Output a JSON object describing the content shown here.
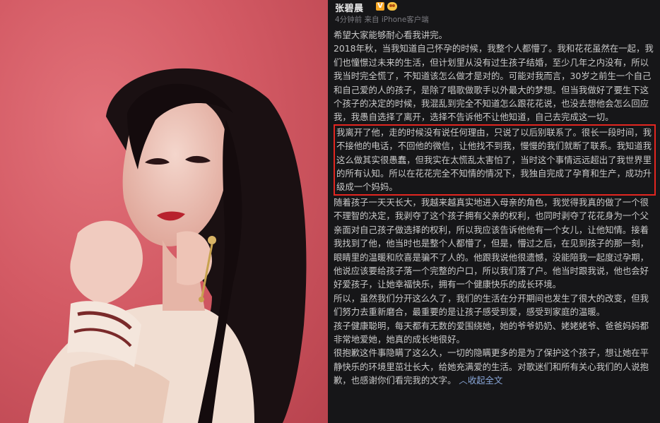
{
  "post": {
    "username": "张碧晨",
    "verified_badge": "V",
    "meta": "4分钟前 来自 iPhone客户端",
    "paragraphs": [
      "希望大家能够耐心看我讲完。",
      "2018年秋，当我知道自己怀孕的时候，我整个人都懵了。我和花花虽然在一起，我们也憧憬过未来的生活，但计划里从没有过生孩子结婚，至少几年之内没有，所以我当时完全慌了，不知道该怎么做才是对的。可能对我而言，30岁之前生一个自己和自己爱的人的孩子，是除了唱歌做歌手以外最大的梦想。但当我做好了要生下这个孩子的决定的时候，我混乱到完全不知道怎么跟花花说，也没去想他会怎么回应我，我愚自选择了离开，选择不告诉他不让他知道，自己去完成这一切。"
    ],
    "highlighted": "我离开了他，走的时候没有说任何理由，只说了以后别联系了。很长一段时间，我不接他的电话，不回他的微信，让他找不到我，慢慢的我们就断了联系。我知道我这么做其实很愚蠢，但我实在太慌乱太害怕了，当时这个事情远远超出了我世界里的所有认知。所以在花花完全不知情的情况下，我独自完成了孕育和生产，成功升级成一个妈妈。",
    "after": [
      "随着孩子一天天长大，我越来越真实地进入母亲的角色，我觉得我真的做了一个很不理智的决定，我剥夺了这个孩子拥有父亲的权利，也同时剥夺了花花身为一个父亲面对自己孩子做选择的权利，所以我应该告诉他他有一个女儿，让他知情。接着我找到了他，他当时也是整个人都懵了，但是，懵过之后，在见到孩子的那一刻，眼睛里的温暖和欣喜是骗不了人的。他跟我说他很遗憾，没能陪我一起度过孕期，他说应该要给孩子落一个完整的户口，所以我们落了户。他当时跟我说，他也会好好爱孩子，让她幸福快乐，拥有一个健康快乐的成长环境。",
      "所以，虽然我们分开这么久了，我们的生活在分开期间也发生了很大的改变，但我们努力去重新磨合，最重要的是让孩子感受到爱，感受到家庭的温暖。",
      "孩子健康聪明，每天都有无数的爱围绕她，她的爷爷奶奶、姥姥姥爷、爸爸妈妈都非常地爱她，她真的成长地很好。",
      "很抱歉这件事隐瞒了这么久，一切的隐瞒更多的是为了保护这个孩子，想让她在平静快乐的环境里茁壮长大，给她充满爱的生活。对歌迷们和所有关心我们的人说抱歉，也感谢你们看完我的文字。"
    ],
    "collapse_label": "收起全文",
    "collapse_caret": "︿"
  },
  "colors": {
    "post_background": "#161618",
    "highlight_border": "#e32620",
    "link": "#8aa7d8",
    "photo_background": "#d35a64"
  }
}
